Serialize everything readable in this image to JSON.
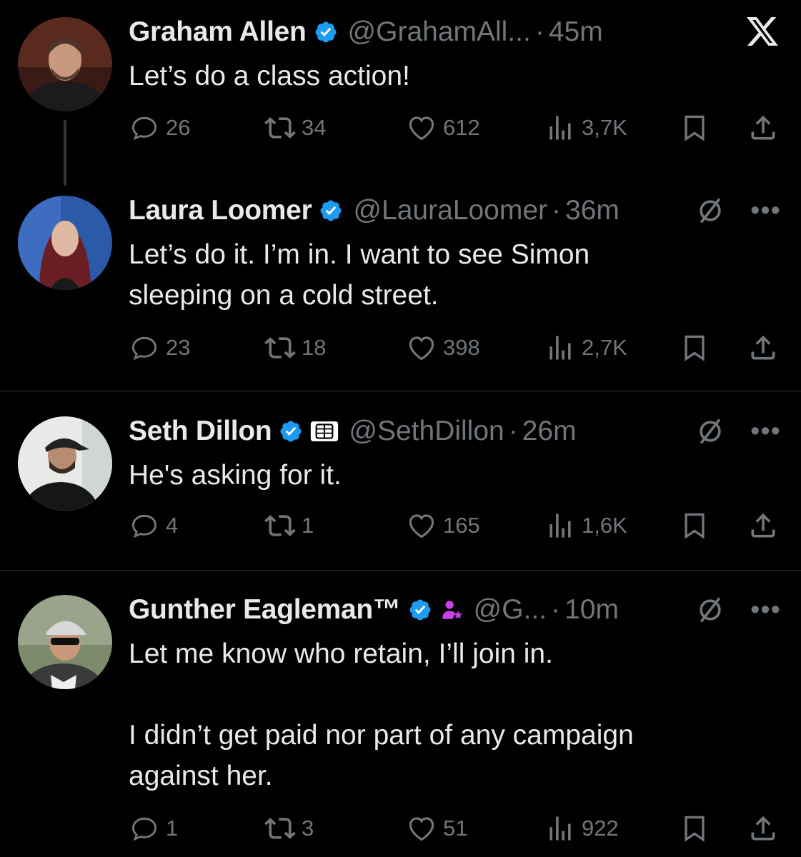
{
  "tweets": [
    {
      "name": "Graham Allen",
      "handle": "@GrahamAll...",
      "time": "45m",
      "text": "Let’s do a class action!",
      "replies": "26",
      "retweets": "34",
      "likes": "612",
      "views": "3,7K"
    },
    {
      "name": "Laura Loomer",
      "handle": "@LauraLoomer",
      "time": "36m",
      "text": "Let’s do it. I’m in. I want to see Simon\nsleeping on a cold street.",
      "replies": "23",
      "retweets": "18",
      "likes": "398",
      "views": "2,7K"
    },
    {
      "name": "Seth Dillon",
      "handle": "@SethDillon",
      "time": "26m",
      "text": "He's asking for it.",
      "replies": "4",
      "retweets": "1",
      "likes": "165",
      "views": "1,6K"
    },
    {
      "name": "Gunther Eagleman™",
      "handle": "@G...",
      "time": "10m",
      "text": "Let me know who retain, I’ll join in.\n\nI didn’t get paid nor part of any campaign\nagainst her.",
      "replies": "1",
      "retweets": "3",
      "likes": "51",
      "views": "922"
    }
  ],
  "separator": "·",
  "icons": {
    "verified": "verified-badge-icon",
    "reply": "reply-icon",
    "retweet": "retweet-icon",
    "like": "heart-icon",
    "views": "views-icon",
    "bookmark": "bookmark-icon",
    "share": "share-icon",
    "grok": "grok-icon",
    "more": "more-icon",
    "x_logo": "x-logo-icon"
  },
  "colors": {
    "background": "#000000",
    "text": "#e7e9ea",
    "muted": "#71767b",
    "verified": "#1d9bf0",
    "subscription_badge": "#c840e9"
  }
}
